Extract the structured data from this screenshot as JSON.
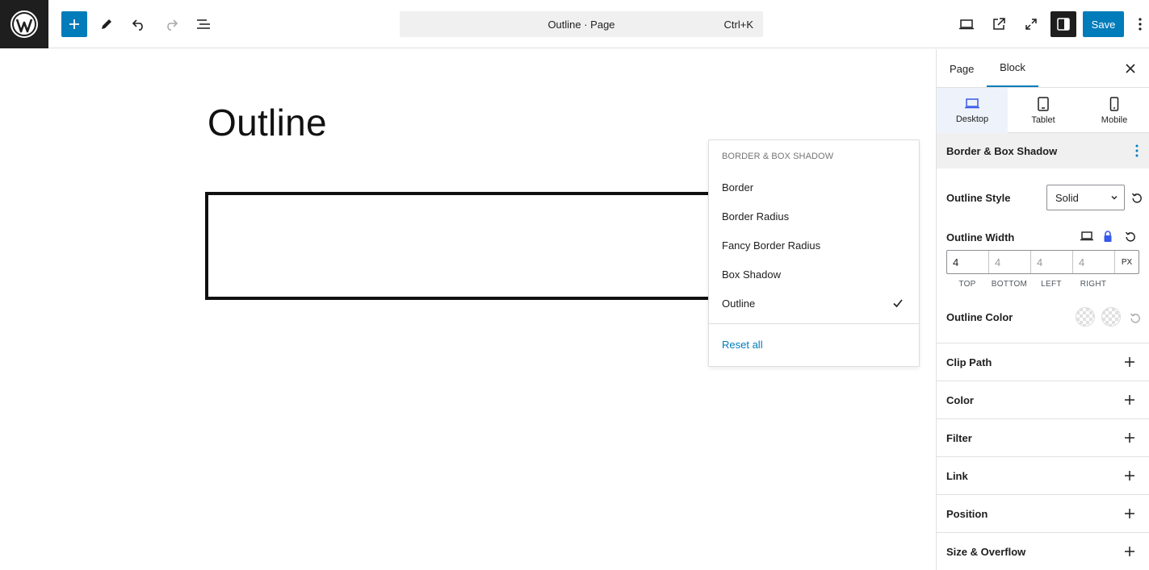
{
  "topbar": {
    "command_title": "Outline · Page",
    "command_shortcut": "Ctrl+K",
    "save_label": "Save",
    "icons": [
      "wordpress-logo",
      "plus-icon",
      "pencil-icon",
      "undo-icon",
      "redo-icon",
      "list-view-icon",
      "desktop-preview-icon",
      "external-link-icon",
      "fullscreen-icon",
      "settings-panel-icon",
      "more-vertical-icon"
    ]
  },
  "canvas": {
    "title": "Outline"
  },
  "menu": {
    "heading": "BORDER & BOX SHADOW",
    "items": [
      {
        "label": "Border",
        "checked": false
      },
      {
        "label": "Border Radius",
        "checked": false
      },
      {
        "label": "Fancy Border Radius",
        "checked": false
      },
      {
        "label": "Box Shadow",
        "checked": false
      },
      {
        "label": "Outline",
        "checked": true
      }
    ],
    "reset_label": "Reset all"
  },
  "sidebar": {
    "tabs": [
      {
        "label": "Page"
      },
      {
        "label": "Block",
        "active": true
      }
    ],
    "devices": [
      {
        "label": "Desktop",
        "active": true
      },
      {
        "label": "Tablet"
      },
      {
        "label": "Mobile"
      }
    ],
    "section_title": "Border & Box Shadow",
    "outline_style": {
      "label": "Outline Style",
      "value": "Solid"
    },
    "outline_width": {
      "label": "Outline Width",
      "values": [
        "4",
        "4",
        "4",
        "4"
      ],
      "sides": [
        "TOP",
        "BOTTOM",
        "LEFT",
        "RIGHT"
      ],
      "unit": "PX"
    },
    "outline_color": {
      "label": "Outline Color"
    },
    "panels": [
      {
        "label": "Clip Path"
      },
      {
        "label": "Color"
      },
      {
        "label": "Filter"
      },
      {
        "label": "Link"
      },
      {
        "label": "Position"
      },
      {
        "label": "Size & Overflow"
      }
    ]
  },
  "colors": {
    "accent": "#007cba",
    "dark": "#1e1e1e",
    "lock": "#3858e9"
  }
}
